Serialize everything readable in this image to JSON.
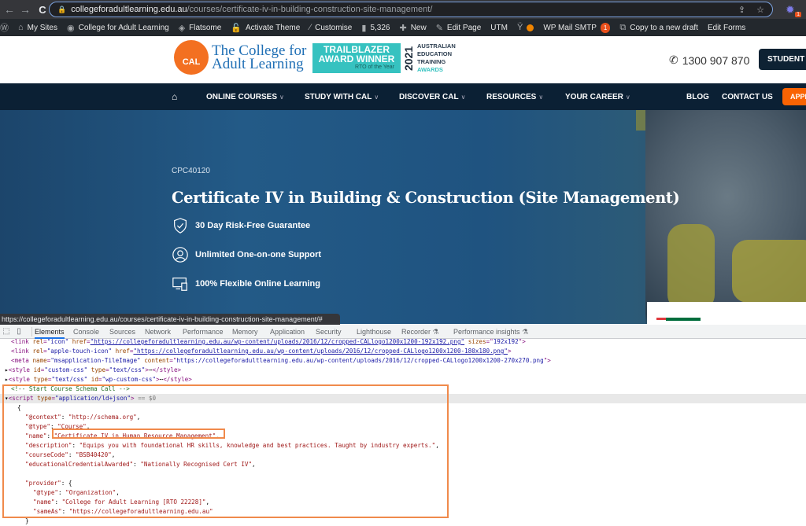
{
  "browser": {
    "url_host": "collegeforadultlearning.edu.au",
    "url_path": "/courses/certificate-iv-in-building-construction-site-management/",
    "extension_badge": "1"
  },
  "wp_admin_bar": {
    "items": [
      {
        "icon": "wordpress-icon",
        "label": ""
      },
      {
        "icon": "my-sites-icon",
        "label": "My Sites"
      },
      {
        "icon": "dashboard-icon",
        "label": "College for Adult Learning"
      },
      {
        "icon": "flatsome-icon",
        "label": "Flatsome"
      },
      {
        "icon": "lock-icon",
        "label": "Activate Theme"
      },
      {
        "icon": "brush-icon",
        "label": "Customise"
      },
      {
        "icon": "comment-icon",
        "label": "5,326"
      },
      {
        "icon": "plus-icon",
        "label": "New"
      },
      {
        "icon": "pencil-icon",
        "label": "Edit Page"
      },
      {
        "icon": "",
        "label": "UTM"
      },
      {
        "icon": "yoast-icon",
        "label": ""
      },
      {
        "icon": "",
        "label": "WP Mail SMTP",
        "badge": "1"
      },
      {
        "icon": "copy-icon",
        "label": "Copy to a new draft"
      },
      {
        "icon": "",
        "label": "Edit Forms"
      }
    ]
  },
  "header": {
    "logo_badge": "CAL",
    "logo_line1": "The College for",
    "logo_line2": "Adult Learning",
    "award_line1": "TRAILBLAZER",
    "award_line2": "AWARD WINNER",
    "award_sub": "RTO of the Year",
    "award_year": "2021",
    "aeta": [
      "AUSTRALIAN",
      "EDUCATION",
      "TRAINING",
      "AWARDS"
    ],
    "phone": "1300 907 870",
    "student_button": "STUDENT"
  },
  "nav": {
    "items": [
      "ONLINE COURSES",
      "STUDY WITH CAL",
      "DISCOVER CAL",
      "RESOURCES",
      "YOUR CAREER"
    ],
    "blog": "BLOG",
    "contact": "CONTACT US",
    "apply": "APPLY"
  },
  "hero": {
    "course_code": "CPC40120",
    "title": "Certificate IV in Building & Construction (Site Management)",
    "features": [
      "30 Day Risk-Free Guarantee",
      "Unlimited One-on-one Support",
      "100% Flexible Online Learning"
    ]
  },
  "status_url": "https://collegeforadultlearning.edu.au/courses/certificate-iv-in-building-construction-site-management/#",
  "devtools": {
    "tabs": [
      "Elements",
      "Console",
      "Sources",
      "Network",
      "Performance",
      "Memory",
      "Application",
      "Security",
      "Lighthouse",
      "Recorder",
      "Performance insights"
    ],
    "active_tab": "Elements",
    "lines": {
      "l1_url": "https://collegeforadultlearning.edu.au/wp-content/uploads/2016/12/cropped-CALlogo1200x1200-192x192.png",
      "l1_sizes": "192x192",
      "l2_url": "https://collegeforadultlearning.edu.au/wp-content/uploads/2016/12/cropped-CALlogo1200x1200-180x180.png",
      "l3_content": "https://collegeforadultlearning.edu.au/wp-content/uploads/2016/12/cropped-CALlogo1200x1200-270x270.png",
      "comment": "<!-- Start Course Schema Call -->",
      "script_suffix": "== $0",
      "context": "\"http://schema.org\"",
      "type": "\"Course\"",
      "name": "\"Certificate IV in Human Resource Management\"",
      "description": "\"Equips you with foundational HR skills, knowledge and best practices. Taught by industry experts.\"",
      "courseCode": "\"BSB40420\"",
      "credential": "\"Nationally Recognised Cert IV\"",
      "provider_type": "\"Organization\"",
      "provider_name": "\"College for Adult Learning [RTO 22228]\"",
      "provider_sameAs": "\"https://collegeforadultlearning.edu.au\""
    }
  }
}
